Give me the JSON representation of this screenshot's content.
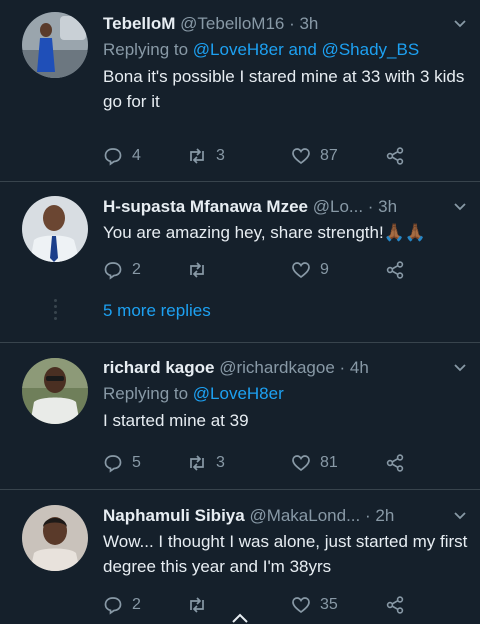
{
  "tweets": [
    {
      "name": "TebelloM",
      "handle": "@TebelloM16 · 3h",
      "replying_prefix": "Replying to ",
      "replying_mentions": "@LoveH8er and @Shady_BS",
      "text": "Bona it's possible I stared mine at 33 with 3 kids go for it",
      "replies": "4",
      "retweets": "3",
      "likes": "87"
    },
    {
      "name": "H-supasta Mfanawa Mzee",
      "handle": "@Lo... · 3h",
      "text": "You are amazing hey, share strength!🙏🏾🙏🏾",
      "replies": "2",
      "retweets": "",
      "likes": "9"
    },
    {
      "name": "richard kagoe",
      "handle": "@richardkagoe · 4h",
      "replying_prefix": "Replying to ",
      "replying_mentions": "@LoveH8er",
      "text": "I started mine at 39",
      "replies": "5",
      "retweets": "3",
      "likes": "81"
    },
    {
      "name": "Naphamuli Sibiya",
      "handle": "@MakaLond... · 2h",
      "text": "Wow... I thought I was alone, just started my first degree this year and I'm 38yrs",
      "replies": "2",
      "retweets": "",
      "likes": "35"
    }
  ],
  "more_replies": "5 more replies",
  "icons": [
    "reply-icon",
    "retweet-icon",
    "like-icon",
    "share-icon",
    "chevron-down-icon",
    "caret-up-icon"
  ],
  "colors": {
    "background": "#15202b",
    "accent": "#1da1f2",
    "muted": "#8899a6",
    "text": "#e7edf2"
  }
}
